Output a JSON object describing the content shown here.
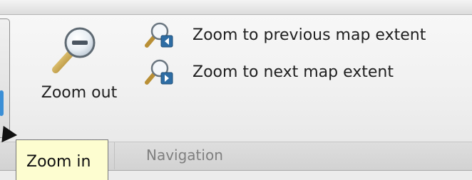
{
  "ribbon": {
    "group_label": "Navigation",
    "buttons": {
      "zoom_out": {
        "label": "Zoom out",
        "icon": "zoom-out-magnifier-icon"
      },
      "zoom_previous": {
        "label": "Zoom to previous map extent",
        "icon": "zoom-previous-extent-icon"
      },
      "zoom_next": {
        "label": "Zoom to next map extent",
        "icon": "zoom-next-extent-icon"
      }
    },
    "partial_button": {
      "icon": "zoom-in-icon"
    }
  },
  "tooltip": {
    "text": "Zoom in"
  },
  "colors": {
    "tooltip_bg": "#fdfdd0",
    "accent_blue": "#3b8fd6",
    "magnifier_handle": "#c9a64a"
  }
}
